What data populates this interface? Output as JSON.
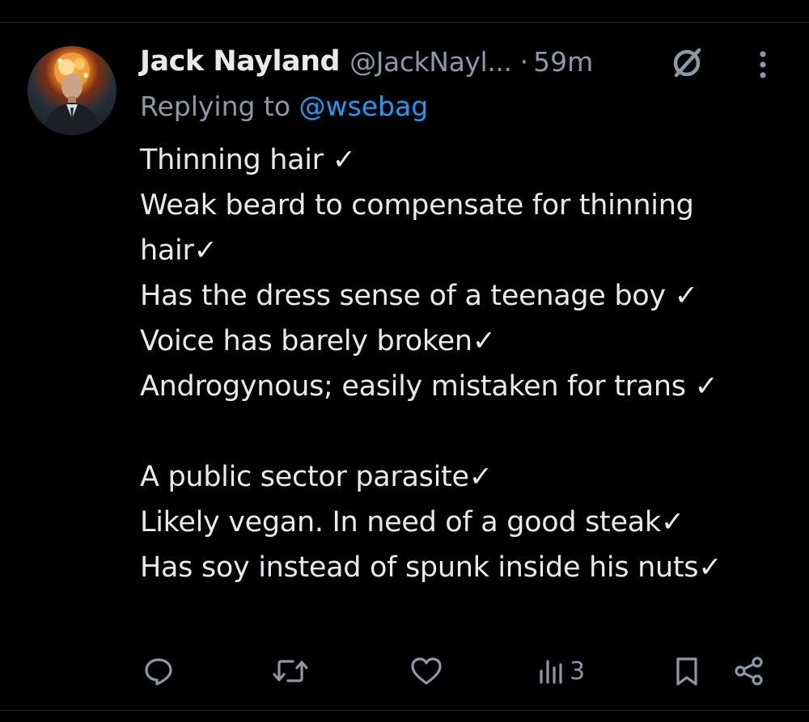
{
  "colors": {
    "background": "#000000",
    "text_primary": "#e7e9ea",
    "text_secondary": "#8b98a5",
    "mention": "#1d9bf0"
  },
  "tweet": {
    "author": {
      "display_name": "Jack Nayland",
      "handle": "@JackNayl...",
      "avatar_icon": "avatar-image"
    },
    "separator": "·",
    "timestamp": "59m",
    "reply": {
      "prefix": "Replying to ",
      "mention": "@wsebag"
    },
    "body": "Thinning hair ✓\nWeak beard to compensate for thinning hair✓\nHas the dress sense of a teenage boy ✓\nVoice has barely broken✓\nAndrogynous; easily mistaken for trans ✓\n\nA public sector parasite✓\nLikely vegan. In need of a good steak✓\nHas soy instead of spunk inside his nuts✓",
    "icons": {
      "grok": "grok-slash-icon",
      "more": "more-vertical-icon"
    },
    "actions": {
      "reply_icon": "reply-icon",
      "retweet_icon": "retweet-icon",
      "like_icon": "heart-icon",
      "views_icon": "views-icon",
      "views_count": "3",
      "bookmark_icon": "bookmark-icon",
      "share_icon": "share-icon"
    }
  }
}
